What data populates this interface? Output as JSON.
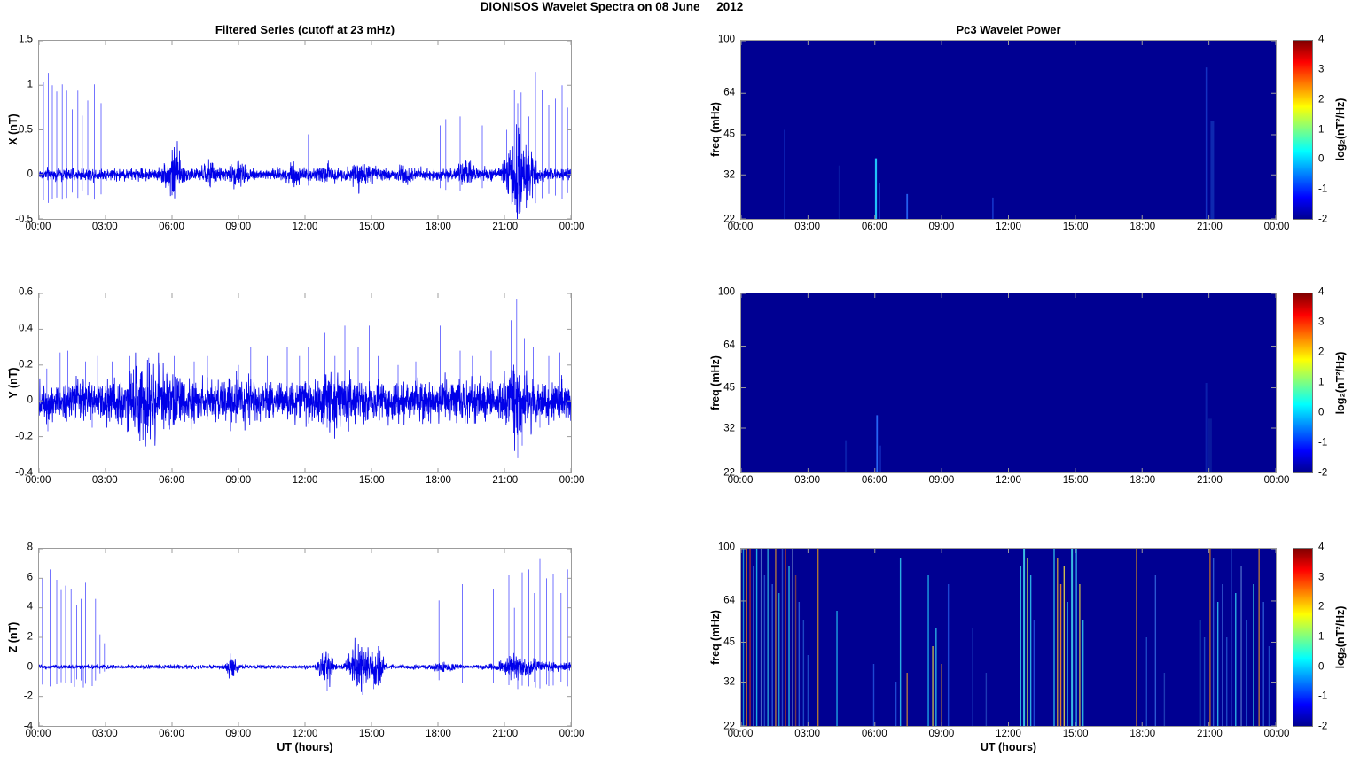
{
  "figure": {
    "suptitle": "DIONISOS Wavelet Spectra on 08 June     2012"
  },
  "labels": {
    "left_title": "Filtered Series (cutoff at 23 mHz)",
    "right_title": "Pc3 Wavelet Power",
    "ut": "UT (hours)",
    "freq": "freq (mHz)",
    "colorbar": "log₂(nT²/Hz)"
  },
  "colors": {
    "line": "#0000e8",
    "spike": "rgba(0,0,255,0.55)",
    "axis": "#9c9c9c",
    "spectro_bg": "#000092",
    "jet_stops": [
      "#000090",
      "#0000ff",
      "#00ffff",
      "#ffff00",
      "#ff0000",
      "#7f0000"
    ]
  },
  "xticks": {
    "hours": [
      0,
      3,
      6,
      9,
      12,
      15,
      18,
      21,
      24
    ],
    "labels": [
      "00:00",
      "03:00",
      "06:00",
      "09:00",
      "12:00",
      "15:00",
      "18:00",
      "21:00",
      "00:00"
    ]
  },
  "colorbar": {
    "min": -2,
    "max": 4,
    "ticks": [
      4,
      3,
      2,
      1,
      0,
      -1,
      -2
    ]
  },
  "chart_data": [
    {
      "type": "line",
      "panel": "X",
      "title": "Filtered Series (cutoff at 23 mHz)",
      "ylabel": "X (nT)",
      "ylim": [
        -0.5,
        1.5
      ],
      "yticks": [
        "1.5",
        "1",
        "0.5",
        "0",
        "-0.5"
      ],
      "ytick_vals": [
        1.5,
        1,
        0.5,
        0,
        -0.5
      ],
      "x_range_hours": [
        0,
        24
      ],
      "noise_base": 0.03,
      "mirror": 0.28,
      "noise_bursts": [
        [
          6.1,
          0.35,
          0.11
        ],
        [
          7.7,
          0.25,
          0.045
        ],
        [
          9.0,
          0.35,
          0.04
        ],
        [
          11.5,
          0.3,
          0.035
        ],
        [
          13.0,
          0.3,
          0.03
        ],
        [
          14.5,
          0.35,
          0.045
        ],
        [
          16.4,
          0.4,
          0.03
        ],
        [
          19.3,
          0.3,
          0.04
        ],
        [
          21.55,
          0.45,
          0.18
        ],
        [
          22.2,
          0.3,
          0.07
        ]
      ],
      "spikes": [
        [
          0.2,
          1.04
        ],
        [
          0.42,
          1.14
        ],
        [
          0.6,
          1.0
        ],
        [
          0.8,
          0.93
        ],
        [
          1.05,
          1.01
        ],
        [
          1.25,
          0.94
        ],
        [
          1.5,
          0.73
        ],
        [
          1.75,
          0.94
        ],
        [
          1.95,
          0.66
        ],
        [
          2.2,
          0.83
        ],
        [
          2.5,
          1.01
        ],
        [
          2.8,
          0.8
        ],
        [
          12.15,
          0.45
        ],
        [
          18.1,
          0.55
        ],
        [
          18.35,
          0.62
        ],
        [
          19.0,
          0.65
        ],
        [
          20.0,
          0.55
        ],
        [
          21.1,
          0.5
        ],
        [
          21.45,
          0.95
        ],
        [
          21.6,
          0.8
        ],
        [
          21.75,
          0.92
        ],
        [
          22.1,
          0.65
        ],
        [
          22.4,
          1.15
        ],
        [
          22.7,
          0.95
        ],
        [
          23.0,
          0.78
        ],
        [
          23.3,
          0.85
        ],
        [
          23.6,
          1.0
        ],
        [
          23.85,
          0.75
        ]
      ]
    },
    {
      "type": "line",
      "panel": "Y",
      "title": "",
      "ylabel": "Y (nT)",
      "ylim": [
        -0.4,
        0.6
      ],
      "yticks": [
        "0.6",
        "0.4",
        "0.2",
        "0",
        "-0.2",
        "-0.4"
      ],
      "ytick_vals": [
        0.6,
        0.4,
        0.2,
        0,
        -0.2,
        -0.4
      ],
      "x_range_hours": [
        0,
        24
      ],
      "noise_base": 0.048,
      "mirror": 0.12,
      "noise_bursts": [
        [
          4.5,
          0.8,
          0.025
        ],
        [
          5.3,
          1.2,
          0.03
        ],
        [
          8.8,
          0.5,
          0.02
        ],
        [
          13.5,
          1.0,
          0.02
        ],
        [
          21.6,
          0.5,
          0.06
        ]
      ],
      "spikes": [
        [
          0.35,
          0.18
        ],
        [
          0.95,
          0.27
        ],
        [
          1.3,
          0.28
        ],
        [
          2.1,
          0.22
        ],
        [
          2.65,
          0.25
        ],
        [
          3.3,
          0.22
        ],
        [
          4.1,
          0.25
        ],
        [
          4.95,
          0.24
        ],
        [
          5.4,
          0.2
        ],
        [
          6.1,
          0.25
        ],
        [
          7.0,
          0.22
        ],
        [
          7.6,
          0.25
        ],
        [
          8.3,
          0.26
        ],
        [
          9.0,
          0.2
        ],
        [
          9.55,
          0.3
        ],
        [
          10.3,
          0.25
        ],
        [
          11.2,
          0.3
        ],
        [
          11.75,
          0.25
        ],
        [
          12.15,
          0.3
        ],
        [
          12.9,
          0.38
        ],
        [
          13.35,
          0.25
        ],
        [
          13.8,
          0.42
        ],
        [
          14.4,
          0.3
        ],
        [
          14.9,
          0.42
        ],
        [
          15.3,
          0.25
        ],
        [
          16.2,
          0.2
        ],
        [
          17.0,
          0.22
        ],
        [
          18.1,
          0.42
        ],
        [
          19.0,
          0.28
        ],
        [
          19.55,
          0.25
        ],
        [
          20.4,
          0.28
        ],
        [
          21.3,
          0.45
        ],
        [
          21.55,
          0.57
        ],
        [
          21.7,
          0.5
        ],
        [
          21.9,
          0.35
        ],
        [
          22.3,
          0.3
        ],
        [
          23.0,
          0.25
        ],
        [
          23.5,
          0.27
        ],
        [
          0.4,
          -0.17
        ],
        [
          2.4,
          -0.15
        ],
        [
          5.9,
          -0.16
        ],
        [
          13.0,
          -0.15
        ],
        [
          21.6,
          -0.32
        ],
        [
          21.8,
          -0.25
        ],
        [
          22.6,
          -0.15
        ]
      ]
    },
    {
      "type": "line",
      "panel": "Z",
      "title": "",
      "xlabel": "UT (hours)",
      "ylabel": "Z (nT)",
      "ylim": [
        -4,
        8
      ],
      "yticks": [
        "8",
        "6",
        "4",
        "2",
        "0",
        "-2",
        "-4"
      ],
      "ytick_vals": [
        8,
        6,
        4,
        2,
        0,
        -2,
        -4
      ],
      "x_range_hours": [
        0,
        24
      ],
      "noise_base": 0.06,
      "mirror": 0.2,
      "noise_bursts": [
        [
          8.7,
          0.22,
          0.35
        ],
        [
          12.9,
          0.3,
          0.42
        ],
        [
          13.1,
          0.15,
          0.3
        ],
        [
          14.2,
          0.3,
          0.5
        ],
        [
          14.6,
          0.3,
          0.5
        ],
        [
          15.0,
          0.3,
          0.45
        ],
        [
          15.35,
          0.2,
          0.4
        ],
        [
          18.3,
          0.5,
          0.1
        ],
        [
          21.5,
          0.7,
          0.22
        ],
        [
          22.8,
          1.2,
          0.1
        ]
      ],
      "spikes": [
        [
          0.15,
          6.0
        ],
        [
          0.5,
          6.6
        ],
        [
          0.8,
          5.9
        ],
        [
          1.0,
          5.2
        ],
        [
          1.2,
          5.5
        ],
        [
          1.45,
          5.3
        ],
        [
          1.7,
          4.2
        ],
        [
          1.9,
          4.6
        ],
        [
          2.1,
          5.7
        ],
        [
          2.3,
          4.3
        ],
        [
          2.55,
          4.6
        ],
        [
          2.75,
          2.2
        ],
        [
          2.95,
          1.6
        ],
        [
          8.65,
          0.9
        ],
        [
          12.85,
          1.0
        ],
        [
          13.05,
          0.9
        ],
        [
          14.15,
          1.2
        ],
        [
          14.5,
          1.1
        ],
        [
          15.05,
          1.0
        ],
        [
          15.3,
          1.4
        ],
        [
          18.05,
          4.5
        ],
        [
          18.5,
          5.2
        ],
        [
          19.1,
          5.6
        ],
        [
          20.5,
          5.3
        ],
        [
          21.2,
          6.2
        ],
        [
          21.45,
          4.0
        ],
        [
          21.8,
          6.4
        ],
        [
          22.1,
          6.6
        ],
        [
          22.35,
          5.0
        ],
        [
          22.6,
          7.3
        ],
        [
          22.9,
          6.0
        ],
        [
          23.2,
          6.3
        ],
        [
          23.55,
          5.0
        ],
        [
          23.85,
          6.6
        ],
        [
          0.9,
          -1.3
        ],
        [
          1.6,
          -1.35
        ],
        [
          2.0,
          -1.4
        ],
        [
          2.4,
          -1.3
        ],
        [
          13.0,
          -1.6
        ],
        [
          14.3,
          -2.2
        ],
        [
          14.6,
          -1.9
        ],
        [
          15.1,
          -1.5
        ],
        [
          21.6,
          -1.5
        ],
        [
          22.4,
          -1.4
        ],
        [
          23.0,
          -1.3
        ]
      ]
    },
    {
      "type": "heatmap",
      "panel": "Pc3-X",
      "title": "Pc3 Wavelet Power",
      "ylabel": "freq (mHz)",
      "yscale": "log2",
      "ytick_freqs": [
        100,
        64,
        45,
        32,
        22
      ],
      "clim": [
        -2,
        4
      ],
      "colorbar_label": "log₂(nT²/Hz)",
      "bg": "#000092",
      "streaks": [
        {
          "t": 1.95,
          "h": 0.5,
          "c": "#0f2cbf",
          "o": 0.9
        },
        {
          "t": 4.4,
          "h": 0.3,
          "c": "#0a1ea8",
          "o": 0.8
        },
        {
          "t": 6.05,
          "h": 0.34,
          "c": "#22ccff",
          "o": 0.95,
          "w": 2.2
        },
        {
          "t": 6.2,
          "h": 0.2,
          "c": "#2a6fff",
          "o": 0.8
        },
        {
          "t": 7.45,
          "h": 0.14,
          "c": "#2a6fff",
          "o": 0.85,
          "w": 1.8
        },
        {
          "t": 11.3,
          "h": 0.12,
          "c": "#2255ee",
          "o": 0.7
        },
        {
          "t": 20.9,
          "h": 0.85,
          "c": "#1636c8",
          "o": 0.9,
          "w": 2.5
        },
        {
          "t": 21.15,
          "h": 0.55,
          "c": "#1232b8",
          "o": 0.8,
          "w": 4
        }
      ]
    },
    {
      "type": "heatmap",
      "panel": "Pc3-Y",
      "title": "",
      "ylabel": "freq (mHz)",
      "yscale": "log2",
      "ytick_freqs": [
        100,
        64,
        45,
        32,
        22
      ],
      "clim": [
        -2,
        4
      ],
      "colorbar_label": "log₂(nT²/Hz)",
      "bg": "#000092",
      "streaks": [
        {
          "t": 4.7,
          "h": 0.18,
          "c": "#0c22ae",
          "o": 0.85,
          "w": 2
        },
        {
          "t": 6.1,
          "h": 0.32,
          "c": "#2a6fff",
          "o": 0.9,
          "w": 1.8
        },
        {
          "t": 6.25,
          "h": 0.15,
          "c": "#1636c8",
          "o": 0.8
        },
        {
          "t": 20.9,
          "h": 0.5,
          "c": "#0c22ae",
          "o": 0.9,
          "w": 3
        },
        {
          "t": 21.05,
          "h": 0.3,
          "c": "#0a1ea0",
          "o": 0.8,
          "w": 4
        }
      ]
    },
    {
      "type": "heatmap",
      "panel": "Pc3-Z",
      "title": "",
      "xlabel": "UT (hours)",
      "ylabel": "freq (mHz)",
      "yscale": "log2",
      "ytick_freqs": [
        100,
        64,
        45,
        32,
        22
      ],
      "clim": [
        -2,
        4
      ],
      "colorbar_label": "log₂(nT²/Hz)",
      "bg": "#000092",
      "streaks": [
        {
          "t": 0.1,
          "h": 1.0,
          "c": "#22aadd"
        },
        {
          "t": 0.25,
          "h": 1.0,
          "c": "#cc7722"
        },
        {
          "t": 0.4,
          "h": 1.0,
          "c": "#bb3322"
        },
        {
          "t": 0.55,
          "h": 0.9,
          "c": "#3366dd"
        },
        {
          "t": 0.7,
          "h": 1.0,
          "c": "#22ccee"
        },
        {
          "t": 0.9,
          "h": 1.0,
          "c": "#5577cc"
        },
        {
          "t": 1.05,
          "h": 0.85,
          "c": "#2255cc"
        },
        {
          "t": 1.2,
          "h": 1.0,
          "c": "#33bbdd"
        },
        {
          "t": 1.4,
          "h": 0.8,
          "c": "#3366dd"
        },
        {
          "t": 1.55,
          "h": 1.0,
          "c": "#cc8833"
        },
        {
          "t": 1.7,
          "h": 0.75,
          "c": "#22aadd"
        },
        {
          "t": 1.85,
          "h": 1.0,
          "c": "#3355cc"
        },
        {
          "t": 2.0,
          "h": 1.0,
          "c": "#993333"
        },
        {
          "t": 2.15,
          "h": 0.9,
          "c": "#33ccee"
        },
        {
          "t": 2.3,
          "h": 1.0,
          "c": "#5566bb"
        },
        {
          "t": 2.45,
          "h": 0.85,
          "c": "#884444"
        },
        {
          "t": 2.6,
          "h": 0.7,
          "c": "#3366dd"
        },
        {
          "t": 2.8,
          "h": 0.6,
          "c": "#2255cc"
        },
        {
          "t": 3.0,
          "h": 0.4,
          "c": "#2255cc"
        },
        {
          "t": 3.45,
          "h": 1.0,
          "c": "#cc8822"
        },
        {
          "t": 4.3,
          "h": 0.65,
          "c": "#22bbee"
        },
        {
          "t": 5.95,
          "h": 0.35,
          "c": "#2255dd"
        },
        {
          "t": 6.95,
          "h": 0.25,
          "c": "#2255dd"
        },
        {
          "t": 7.15,
          "h": 0.95,
          "c": "#33ccee"
        },
        {
          "t": 7.45,
          "h": 0.3,
          "c": "#cc8833"
        },
        {
          "t": 8.4,
          "h": 0.85,
          "c": "#22bbee"
        },
        {
          "t": 8.6,
          "h": 0.45,
          "c": "#ddcc44"
        },
        {
          "t": 8.75,
          "h": 0.55,
          "c": "#33ccee"
        },
        {
          "t": 9.0,
          "h": 0.35,
          "c": "#cc8833"
        },
        {
          "t": 9.3,
          "h": 0.8,
          "c": "#2255dd"
        },
        {
          "t": 10.4,
          "h": 0.55,
          "c": "#2255cc"
        },
        {
          "t": 11.0,
          "h": 0.3,
          "c": "#2244bb"
        },
        {
          "t": 12.55,
          "h": 0.9,
          "c": "#33ccee"
        },
        {
          "t": 12.7,
          "h": 1.0,
          "c": "#44ddee",
          "w": 2
        },
        {
          "t": 12.85,
          "h": 0.95,
          "c": "#bbdd55"
        },
        {
          "t": 13.0,
          "h": 0.85,
          "c": "#33ccee"
        },
        {
          "t": 13.15,
          "h": 0.6,
          "c": "#2255dd"
        },
        {
          "t": 14.05,
          "h": 1.0,
          "c": "#33ccee"
        },
        {
          "t": 14.2,
          "h": 0.95,
          "c": "#ddaa33"
        },
        {
          "t": 14.35,
          "h": 0.8,
          "c": "#ff9922"
        },
        {
          "t": 14.5,
          "h": 0.9,
          "c": "#eedd44"
        },
        {
          "t": 14.65,
          "h": 0.7,
          "c": "#33ccee"
        },
        {
          "t": 14.85,
          "h": 1.0,
          "c": "#44ddee",
          "w": 2
        },
        {
          "t": 15.05,
          "h": 1.0,
          "c": "#33bbee"
        },
        {
          "t": 15.2,
          "h": 0.8,
          "c": "#ddcc44"
        },
        {
          "t": 15.35,
          "h": 0.6,
          "c": "#33ccee"
        },
        {
          "t": 17.75,
          "h": 1.0,
          "c": "#cc8822"
        },
        {
          "t": 18.2,
          "h": 0.5,
          "c": "#2255cc"
        },
        {
          "t": 18.6,
          "h": 0.85,
          "c": "#3366dd"
        },
        {
          "t": 19.0,
          "h": 0.3,
          "c": "#2244bb"
        },
        {
          "t": 20.6,
          "h": 0.6,
          "c": "#33bbdd"
        },
        {
          "t": 20.8,
          "h": 0.5,
          "c": "#2255cc"
        },
        {
          "t": 21.05,
          "h": 1.0,
          "c": "#cc7722"
        },
        {
          "t": 21.2,
          "h": 0.95,
          "c": "#3366dd"
        },
        {
          "t": 21.4,
          "h": 0.7,
          "c": "#33ccee"
        },
        {
          "t": 21.6,
          "h": 0.8,
          "c": "#3355cc"
        },
        {
          "t": 21.8,
          "h": 0.5,
          "c": "#2255cc"
        },
        {
          "t": 22.0,
          "h": 1.0,
          "c": "#3366dd"
        },
        {
          "t": 22.2,
          "h": 0.75,
          "c": "#33ccee"
        },
        {
          "t": 22.45,
          "h": 0.9,
          "c": "#5577cc"
        },
        {
          "t": 22.7,
          "h": 0.6,
          "c": "#2255cc"
        },
        {
          "t": 23.0,
          "h": 0.8,
          "c": "#33bbdd"
        },
        {
          "t": 23.25,
          "h": 1.0,
          "c": "#cc8833"
        },
        {
          "t": 23.45,
          "h": 0.7,
          "c": "#3366dd"
        },
        {
          "t": 23.7,
          "h": 0.45,
          "c": "#2255cc"
        }
      ]
    }
  ]
}
